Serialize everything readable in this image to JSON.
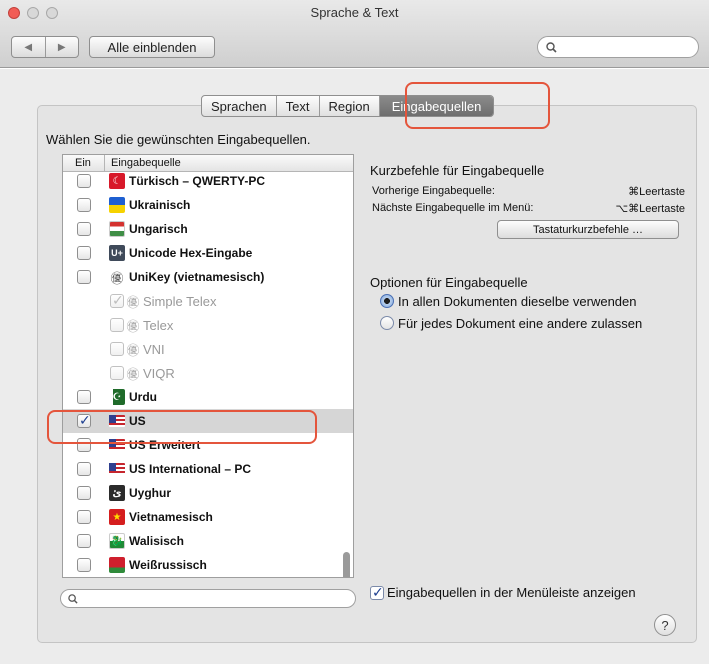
{
  "window": {
    "title": "Sprache & Text"
  },
  "toolbar": {
    "back": "◀",
    "forward": "▶",
    "show_all": "Alle einblenden",
    "search_placeholder": ""
  },
  "tabs": [
    {
      "label": "Sprachen",
      "active": false
    },
    {
      "label": "Text",
      "active": false
    },
    {
      "label": "Region",
      "active": false
    },
    {
      "label": "Eingabequellen",
      "active": true
    }
  ],
  "prompt": "Wählen Sie die gewünschten Eingabequellen.",
  "list": {
    "header_ein": "Ein",
    "header_source": "Eingabequelle",
    "rows": [
      {
        "label": "Türkisch – QWERTY-PC",
        "checked": false,
        "icon": "turkish-flag-icon"
      },
      {
        "label": "Ukrainisch",
        "checked": false,
        "icon": "ukraine-flag-icon"
      },
      {
        "label": "Ungarisch",
        "checked": false,
        "icon": "hungary-flag-icon"
      },
      {
        "label": "Unicode Hex-Eingabe",
        "checked": false,
        "icon": "unicode-icon"
      },
      {
        "label": "UniKey (vietnamesisch)",
        "checked": false,
        "icon": "unikey-globe-icon"
      },
      {
        "label": "Simple Telex",
        "checked": true,
        "sub": true,
        "icon": "unikey-globe-icon"
      },
      {
        "label": "Telex",
        "checked": false,
        "sub": true,
        "icon": "unikey-globe-icon"
      },
      {
        "label": "VNI",
        "checked": false,
        "sub": true,
        "icon": "unikey-globe-icon"
      },
      {
        "label": "VIQR",
        "checked": false,
        "sub": true,
        "icon": "unikey-globe-icon"
      },
      {
        "label": "Urdu",
        "checked": false,
        "icon": "pakistan-flag-icon"
      },
      {
        "label": "US",
        "checked": true,
        "selected": true,
        "icon": "us-flag-icon"
      },
      {
        "label": "US Erweitert",
        "checked": false,
        "icon": "us-flag-icon"
      },
      {
        "label": "US International – PC",
        "checked": false,
        "icon": "us-flag-icon"
      },
      {
        "label": "Uyghur",
        "checked": false,
        "icon": "uyghur-icon"
      },
      {
        "label": "Vietnamesisch",
        "checked": false,
        "icon": "vietnam-flag-icon"
      },
      {
        "label": "Walisisch",
        "checked": false,
        "icon": "wales-flag-icon"
      },
      {
        "label": "Weißrussisch",
        "checked": false,
        "icon": "belarus-flag-icon"
      }
    ]
  },
  "shortcuts": {
    "title": "Kurzbefehle für Eingabequelle",
    "previous_label": "Vorherige Eingabequelle:",
    "previous_key": "⌘Leertaste",
    "next_label": "Nächste Eingabequelle im Menü:",
    "next_key": "⌥⌘Leertaste",
    "button": "Tastaturkurzbefehle …"
  },
  "options": {
    "title": "Optionen für Eingabequelle",
    "radio_same": "In allen Dokumenten dieselbe verwenden",
    "radio_per_doc": "Für jedes Dokument eine andere zulassen",
    "selected": "same"
  },
  "bottom": {
    "list_search_placeholder": "",
    "show_in_menu": "Eingabequellen in der Menüleiste anzeigen",
    "show_in_menu_checked": true,
    "help": "?"
  },
  "colors": {
    "highlight": "#e4553c",
    "active_tab": "#7a7a7a",
    "checkmark": "#1c3e8f"
  }
}
